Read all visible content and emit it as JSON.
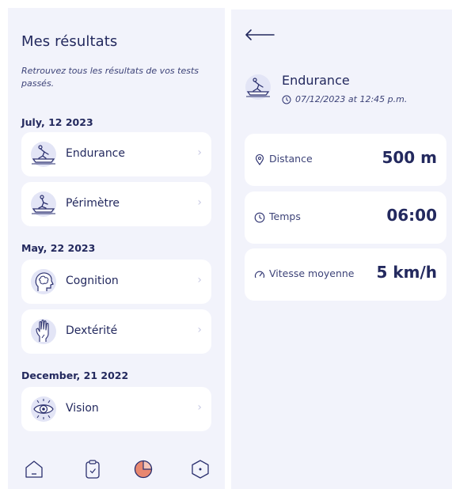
{
  "results_panel": {
    "title": "Mes résultats",
    "subtitle": "Retrouvez tous les résultats de vos tests passés.",
    "groups": [
      {
        "date": "July, 12 2023",
        "items": [
          {
            "label": "Endurance",
            "icon": "treadmill-icon"
          },
          {
            "label": "Périmètre",
            "icon": "treadmill-icon"
          }
        ]
      },
      {
        "date": "May, 22 2023",
        "items": [
          {
            "label": "Cognition",
            "icon": "brain-head-icon"
          },
          {
            "label": "Dextérité",
            "icon": "hand-icon"
          }
        ]
      },
      {
        "date": "December, 21 2022",
        "items": [
          {
            "label": "Vision",
            "icon": "eye-icon"
          }
        ]
      }
    ],
    "chevron": "›"
  },
  "bottom_nav": {
    "items": [
      {
        "icon": "home-icon",
        "active": false
      },
      {
        "icon": "clipboard-icon",
        "active": false
      },
      {
        "icon": "results-pie-icon",
        "active": true
      },
      {
        "icon": "hexagon-settings-icon",
        "active": false
      }
    ]
  },
  "detail_panel": {
    "title": "Endurance",
    "datetime": "07/12/2023 at 12:45 p.m.",
    "stats": [
      {
        "label": "Distance",
        "value": "500 m",
        "icon": "location-pin-icon"
      },
      {
        "label": "Temps",
        "value": "06:00",
        "icon": "clock-icon"
      },
      {
        "label": "Vitesse moyenne",
        "value": "5 km/h",
        "icon": "speedometer-icon"
      }
    ]
  },
  "colors": {
    "background_panel": "#f2f3fb",
    "card": "#ffffff",
    "text_primary": "#23295e",
    "icon_bg": "#e3e5f6",
    "accent_active": "#e8876f"
  }
}
